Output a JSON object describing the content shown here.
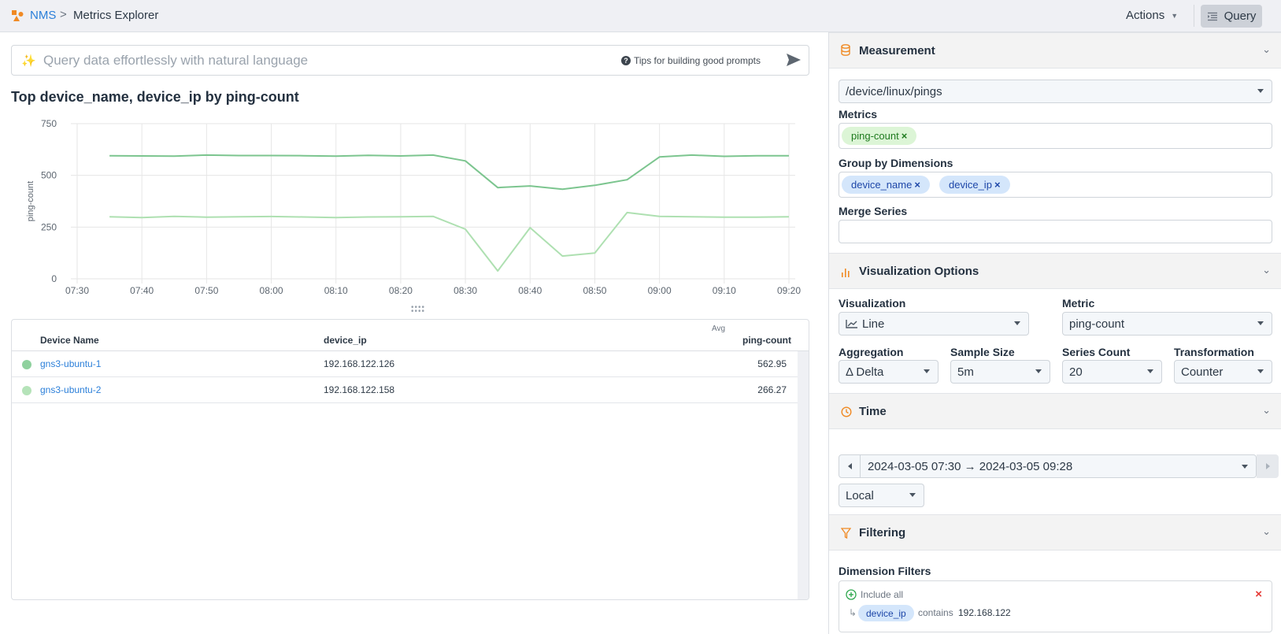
{
  "header": {
    "breadcrumb_root": "NMS",
    "breadcrumb_sep": ">",
    "breadcrumb_current": "Metrics Explorer",
    "actions_label": "Actions",
    "query_label": "Query"
  },
  "nl_query": {
    "placeholder": "Query data effortlessly with natural language",
    "value": "",
    "tips_label": "Tips for building good prompts"
  },
  "chart_title": "Top device_name, device_ip by ping-count",
  "chart_data": {
    "type": "line",
    "title": "Top device_name, device_ip by ping-count",
    "xlabel": "",
    "ylabel": "ping-count",
    "ylim": [
      0,
      750
    ],
    "yticks": [
      0,
      250,
      500,
      750
    ],
    "xticks": [
      "07:30",
      "07:40",
      "07:50",
      "08:00",
      "08:10",
      "08:20",
      "08:30",
      "08:40",
      "08:50",
      "09:00",
      "09:10",
      "09:20"
    ],
    "x_range_minutes": [
      0,
      110
    ],
    "grid": true,
    "x": [
      "07:35",
      "07:40",
      "07:45",
      "07:50",
      "07:55",
      "08:00",
      "08:05",
      "08:10",
      "08:15",
      "08:20",
      "08:25",
      "08:30",
      "08:35",
      "08:40",
      "08:45",
      "08:50",
      "08:55",
      "09:00",
      "09:05",
      "09:10",
      "09:15",
      "09:20"
    ],
    "series": [
      {
        "name": "gns3-ubuntu-1 / 192.168.122.126",
        "color": "#7cc58f",
        "values": [
          595,
          594,
          593,
          598,
          596,
          596,
          595,
          593,
          597,
          594,
          598,
          570,
          441,
          449,
          433,
          452,
          479,
          589,
          598,
          592,
          595,
          595
        ]
      },
      {
        "name": "gns3-ubuntu-2 / 192.168.122.158",
        "color": "#aee0b1",
        "values": [
          300,
          296,
          302,
          298,
          300,
          301,
          299,
          296,
          299,
          300,
          302,
          240,
          38,
          247,
          110,
          125,
          320,
          302,
          300,
          298,
          298,
          300
        ]
      }
    ]
  },
  "table": {
    "columns": {
      "device_name": "Device Name",
      "device_ip": "device_ip",
      "avg_sub": "Avg",
      "ping_count": "ping-count"
    },
    "rows": [
      {
        "device_name": "gns3-ubuntu-1",
        "device_ip": "192.168.122.126",
        "value": "562.95",
        "color": "#8fd19e"
      },
      {
        "device_name": "gns3-ubuntu-2",
        "device_ip": "192.168.122.158",
        "value": "266.27",
        "color": "#b5e3b9"
      }
    ]
  },
  "panel": {
    "measurement": {
      "title": "Measurement",
      "value": "/device/linux/pings",
      "metrics_label": "Metrics",
      "metrics": [
        "ping-count"
      ],
      "group_by_label": "Group by Dimensions",
      "group_by": [
        "device_name",
        "device_ip"
      ],
      "merge_label": "Merge Series",
      "merge_value": ""
    },
    "viz": {
      "title": "Visualization Options",
      "visualization_label": "Visualization",
      "visualization_value": "Line",
      "metric_label": "Metric",
      "metric_value": "ping-count",
      "aggregation_label": "Aggregation",
      "aggregation_value": "Δ Delta",
      "sample_label": "Sample Size",
      "sample_value": "5m",
      "series_label": "Series Count",
      "series_value": "20",
      "transform_label": "Transformation",
      "transform_value": "Counter"
    },
    "time": {
      "title": "Time",
      "range": "2024-03-05 07:30 → 2024-03-05 09:28",
      "tz": "Local"
    },
    "filtering": {
      "title": "Filtering",
      "dim_label": "Dimension Filters",
      "include_all": "Include all",
      "filter_dim": "device_ip",
      "filter_op": "contains",
      "filter_val": "192.168.122"
    }
  },
  "colors": {
    "accent": "#2b7fd9",
    "orange": "#f08a24"
  }
}
